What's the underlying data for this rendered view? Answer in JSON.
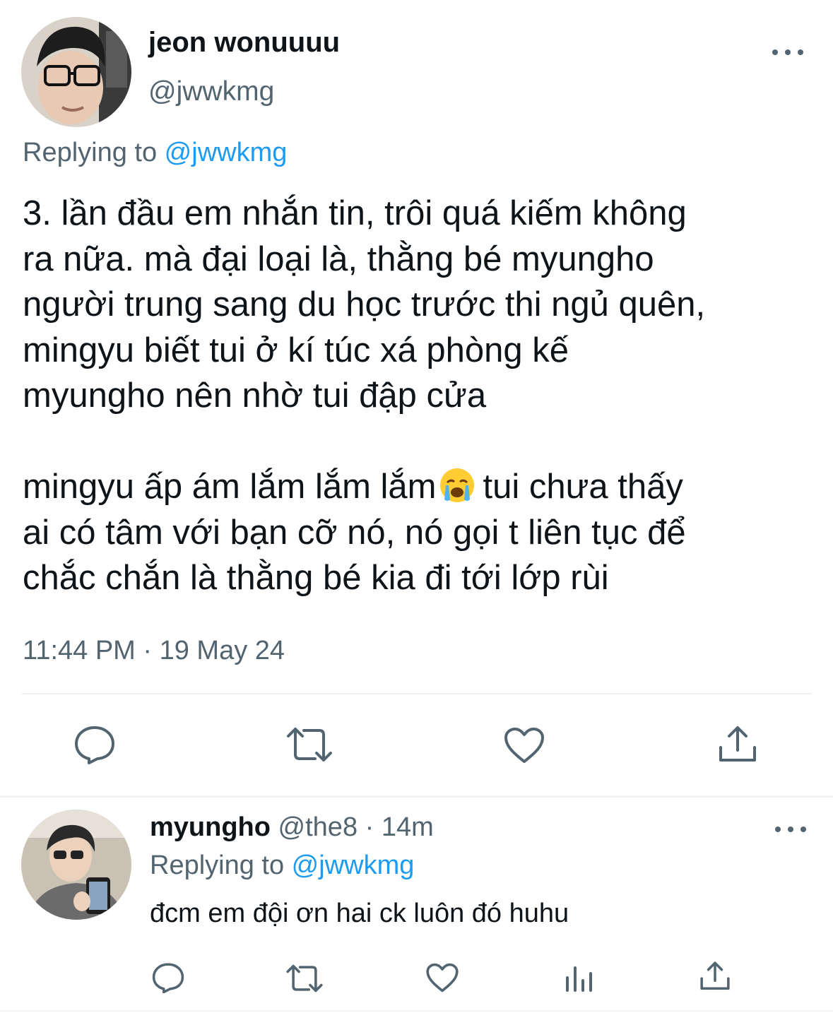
{
  "tweet": {
    "author": {
      "name": "jeon wonuuuu",
      "handle": "@jwwkmg"
    },
    "replying_to_prefix": "Replying to ",
    "replying_to_handle": "@jwwkmg",
    "text_lines": [
      "3. lần đầu em nhắn tin, trôi quá kiếm không",
      "ra nữa. mà đại loại là, thằng bé myungho",
      "người trung sang du học trước thi ngủ quên,",
      "mingyu biết tui ở kí túc xá phòng kế",
      "myungho nên nhờ tui đập cửa"
    ],
    "text_line_emoji_before": "mingyu ấp ám lắm lắm lắm",
    "text_line_emoji_after": "tui chưa thấy",
    "emoji": "crying-face-emoji",
    "text_lines_2": [
      "ai có tâm với bạn cỡ nó, nó gọi t liên tục để",
      "chắc chắn là thằng bé kia đi tới lớp rùi"
    ],
    "timestamp": "11:44 PM · 19 May 24",
    "actions": [
      "reply-icon",
      "retweet-icon",
      "like-icon",
      "share-icon"
    ]
  },
  "reply": {
    "author": {
      "name": "myungho",
      "handle_time": " @the8 · 14m"
    },
    "replying_to_prefix": "Replying to ",
    "replying_to_handle": "@jwwkmg",
    "text": "đcm em đội ơn hai ck luôn đó huhu",
    "actions": [
      "reply-icon",
      "retweet-icon",
      "like-icon",
      "views-icon",
      "share-icon"
    ]
  },
  "colors": {
    "text_primary": "#0f1419",
    "text_secondary": "#536471",
    "link": "#1d9bf0",
    "divider": "#eff3f4"
  }
}
